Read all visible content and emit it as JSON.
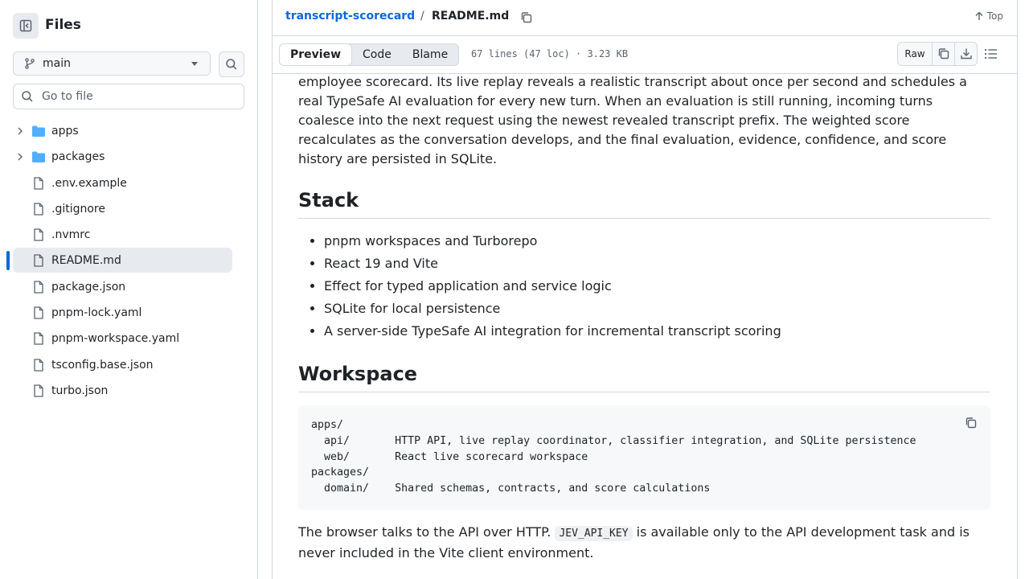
{
  "sidebar": {
    "title": "Files",
    "branch": "main",
    "goto_placeholder": "Go to file",
    "items": [
      {
        "label": "apps",
        "kind": "folder"
      },
      {
        "label": "packages",
        "kind": "folder"
      },
      {
        "label": ".env.example",
        "kind": "file"
      },
      {
        "label": ".gitignore",
        "kind": "file"
      },
      {
        "label": ".nvmrc",
        "kind": "file"
      },
      {
        "label": "README.md",
        "kind": "file",
        "selected": true
      },
      {
        "label": "package.json",
        "kind": "file"
      },
      {
        "label": "pnpm-lock.yaml",
        "kind": "file"
      },
      {
        "label": "pnpm-workspace.yaml",
        "kind": "file"
      },
      {
        "label": "tsconfig.base.json",
        "kind": "file"
      },
      {
        "label": "turbo.json",
        "kind": "file"
      }
    ]
  },
  "header": {
    "repo": "transcript-scorecard",
    "separator": "/",
    "file": "README.md",
    "top_label": "Top"
  },
  "toolbar": {
    "tabs": [
      "Preview",
      "Code",
      "Blame"
    ],
    "active_tab": "Preview",
    "file_info": "67 lines (47 loc) · 3.23 KB",
    "raw_label": "Raw"
  },
  "readme": {
    "intro_lines": [
      "employee scorecard. Its live replay reveals a realistic transcript about once per second and schedules a",
      "real TypeSafe AI evaluation for every new turn. When an evaluation is still running, incoming turns",
      "coalesce into the next request using the newest revealed transcript prefix. The weighted score",
      "recalculates as the conversation develops, and the final evaluation, evidence, confidence, and score",
      "history are persisted in SQLite."
    ],
    "stack_heading": "Stack",
    "stack_items": [
      "pnpm workspaces and Turborepo",
      "React 19 and Vite",
      "Effect for typed application and service logic",
      "SQLite for local persistence",
      "A server-side TypeSafe AI integration for incremental transcript scoring"
    ],
    "workspace_heading": "Workspace",
    "code_lines": [
      "apps/",
      "  api/       HTTP API, live replay coordinator, classifier integration, and SQLite persistence",
      "  web/       React live scorecard workspace",
      "packages/",
      "  domain/    Shared schemas, contracts, and score calculations"
    ],
    "after_text_1": "The browser talks to the API over HTTP. ",
    "inline_code": "JEV_API_KEY",
    "after_text_2": " is available only to the API development task and is",
    "after_text_3": "never included in the Vite client environment."
  },
  "colors": {
    "link": "#0969da",
    "folder": "#54aeff",
    "selected_bar": "#0969da"
  }
}
